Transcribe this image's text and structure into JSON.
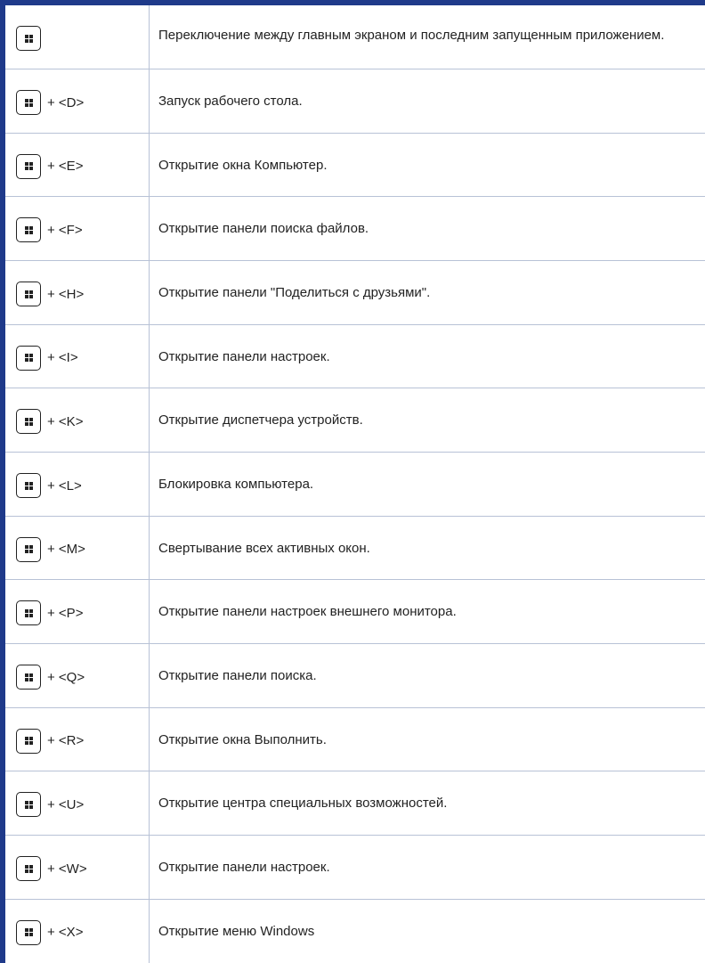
{
  "colors": {
    "accent": "#1f3a8a",
    "rule": "#b8c2d6",
    "text": "#222222"
  },
  "rows": [
    {
      "key": "",
      "description": "Переключение между главным экраном и последним запущенным приложением."
    },
    {
      "key": "+ <D>",
      "description": "Запуск рабочего стола."
    },
    {
      "key": "+ <E>",
      "description": "Открытие окна Компьютер."
    },
    {
      "key": "+ <F>",
      "description": "Открытие панели поиска файлов."
    },
    {
      "key": "+ <H>",
      "description": "Открытие панели \"Поделиться с друзьями\"."
    },
    {
      "key": "+ <I>",
      "description": "Открытие панели настроек."
    },
    {
      "key": "+ <K>",
      "description": "Открытие диспетчера устройств."
    },
    {
      "key": "+ <L>",
      "description": "Блокировка компьютера."
    },
    {
      "key": "+ <M>",
      "description": "Свертывание всех активных окон."
    },
    {
      "key": "+ <P>",
      "description": "Открытие панели настроек внешнего монитора."
    },
    {
      "key": "+ <Q>",
      "description": "Открытие панели поиска."
    },
    {
      "key": "+ <R>",
      "description": "Открытие окна Выполнить."
    },
    {
      "key": "+ <U>",
      "description": "Открытие центра специальных возможностей."
    },
    {
      "key": "+ <W>",
      "description": "Открытие панели настроек."
    },
    {
      "key": "+ <X>",
      "description": "Открытие меню Windows"
    }
  ]
}
